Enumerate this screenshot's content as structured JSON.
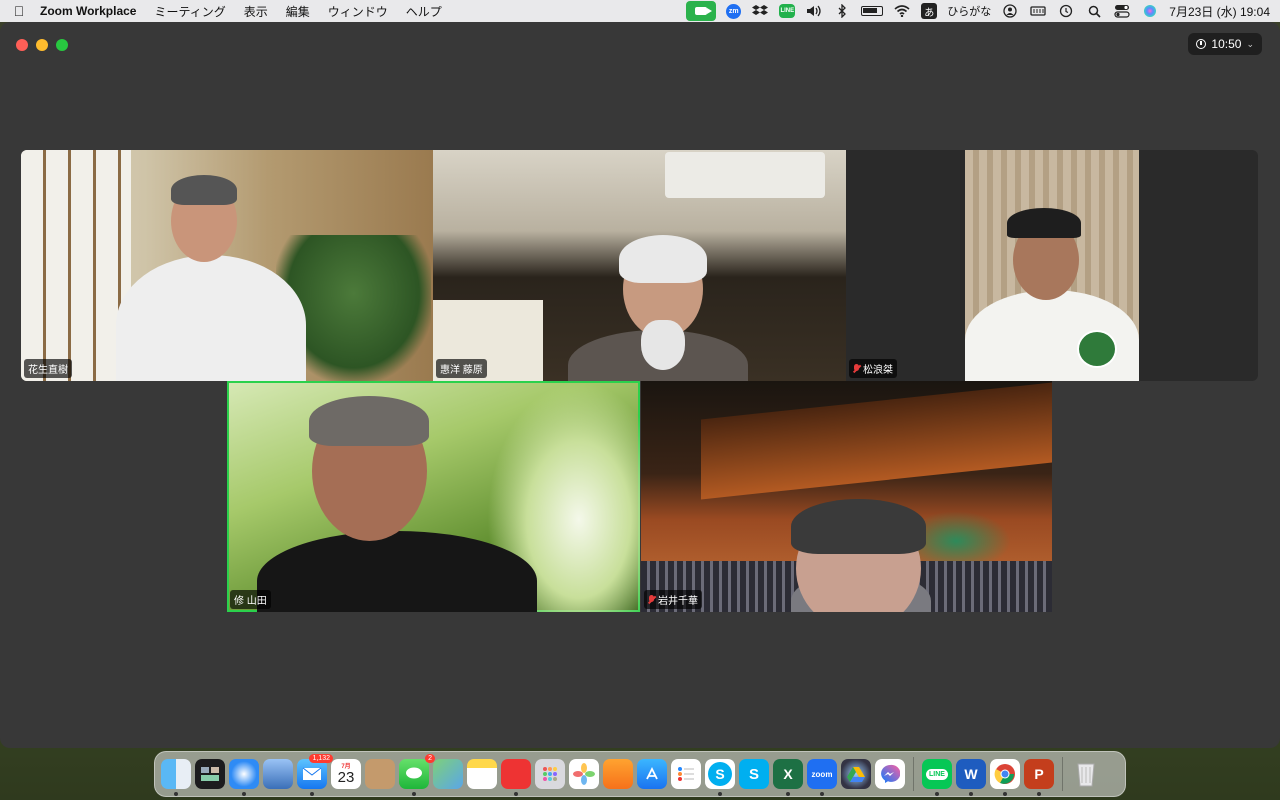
{
  "menubar": {
    "app_name": "Zoom Workplace",
    "menus": [
      "ミーティング",
      "表示",
      "編集",
      "ウィンドウ",
      "ヘルプ"
    ],
    "input_mode": "あ",
    "input_label": "ひらがな",
    "zm_text": "zm",
    "line_text": "LINE",
    "date_time": "7月23日 (水)  19:04"
  },
  "window": {
    "timer": "10:50"
  },
  "participants": [
    {
      "name": "花生直樹",
      "muted": false
    },
    {
      "name": "惠洋 藤原",
      "muted": false
    },
    {
      "name": "松浪桀",
      "muted": true
    },
    {
      "name": "修 山田",
      "muted": false,
      "active_speaker": true
    },
    {
      "name": "岩井千華",
      "muted": true
    }
  ],
  "dock": {
    "mail_badge": "1,132",
    "calendar_month": "7月",
    "calendar_day": "23",
    "messages_badge": "2",
    "icons": {
      "zoom": "zoom",
      "line": "LINE",
      "word": "W",
      "powerpoint": "P",
      "excel": "X",
      "skype": "S"
    }
  }
}
